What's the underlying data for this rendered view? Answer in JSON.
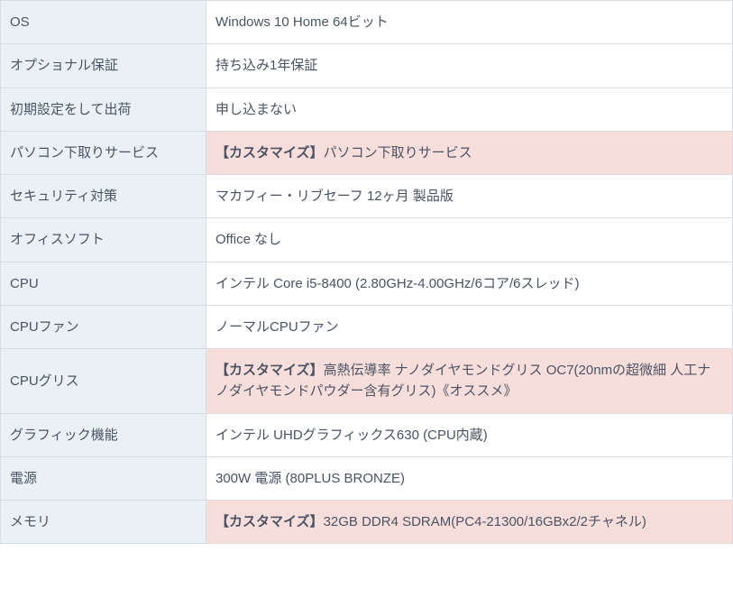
{
  "customPrefix": "【カスタマイズ】",
  "rows": [
    {
      "label": "OS",
      "value": "Windows 10 Home 64ビット",
      "custom": false
    },
    {
      "label": "オプショナル保証",
      "value": "持ち込み1年保証",
      "custom": false
    },
    {
      "label": "初期設定をして出荷",
      "value": "申し込まない",
      "custom": false
    },
    {
      "label": "パソコン下取りサービス",
      "value": "パソコン下取りサービス",
      "custom": true
    },
    {
      "label": "セキュリティ対策",
      "value": "マカフィー・リブセーフ 12ヶ月 製品版",
      "custom": false
    },
    {
      "label": "オフィスソフト",
      "value": "Office なし",
      "custom": false
    },
    {
      "label": "CPU",
      "value": "インテル Core i5-8400 (2.80GHz-4.00GHz/6コア/6スレッド)",
      "custom": false
    },
    {
      "label": "CPUファン",
      "value": "ノーマルCPUファン",
      "custom": false
    },
    {
      "label": "CPUグリス",
      "value": "高熱伝導率 ナノダイヤモンドグリス OC7(20nmの超微細 人工ナノダイヤモンドパウダー含有グリス)《オススメ》",
      "custom": true
    },
    {
      "label": "グラフィック機能",
      "value": "インテル UHDグラフィックス630 (CPU内蔵)",
      "custom": false
    },
    {
      "label": "電源",
      "value": "300W 電源 (80PLUS BRONZE)",
      "custom": false
    },
    {
      "label": "メモリ",
      "value": "32GB DDR4 SDRAM(PC4-21300/16GBx2/2チャネル)",
      "custom": true
    }
  ]
}
